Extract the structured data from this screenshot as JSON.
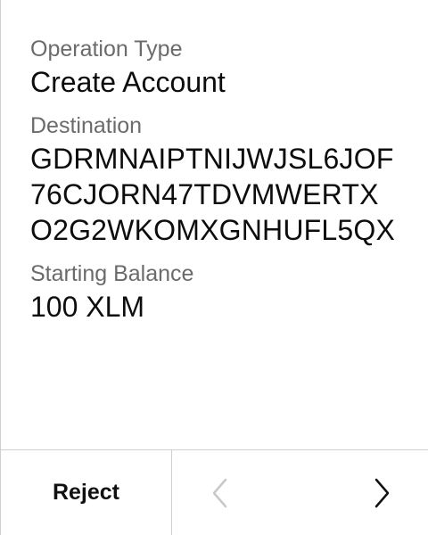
{
  "operation": {
    "label": "Operation Type",
    "value": "Create Account"
  },
  "destination": {
    "label": "Destination",
    "value": "GDRMNAIPTNIJWJSL6JOF76CJORN47TDVMWERTXO2G2WKOMXGNHUFL5QX"
  },
  "starting_balance": {
    "label": "Starting Balance",
    "value": "100 XLM"
  },
  "footer": {
    "reject_label": "Reject",
    "prev_icon": "chevron-left-icon",
    "next_icon": "chevron-right-icon"
  },
  "colors": {
    "label_text": "#6b6b6b",
    "value_text": "#0d0d0d",
    "divider": "#cfcfcf",
    "prev_disabled": "#c8c8c8",
    "next_active": "#111111"
  }
}
